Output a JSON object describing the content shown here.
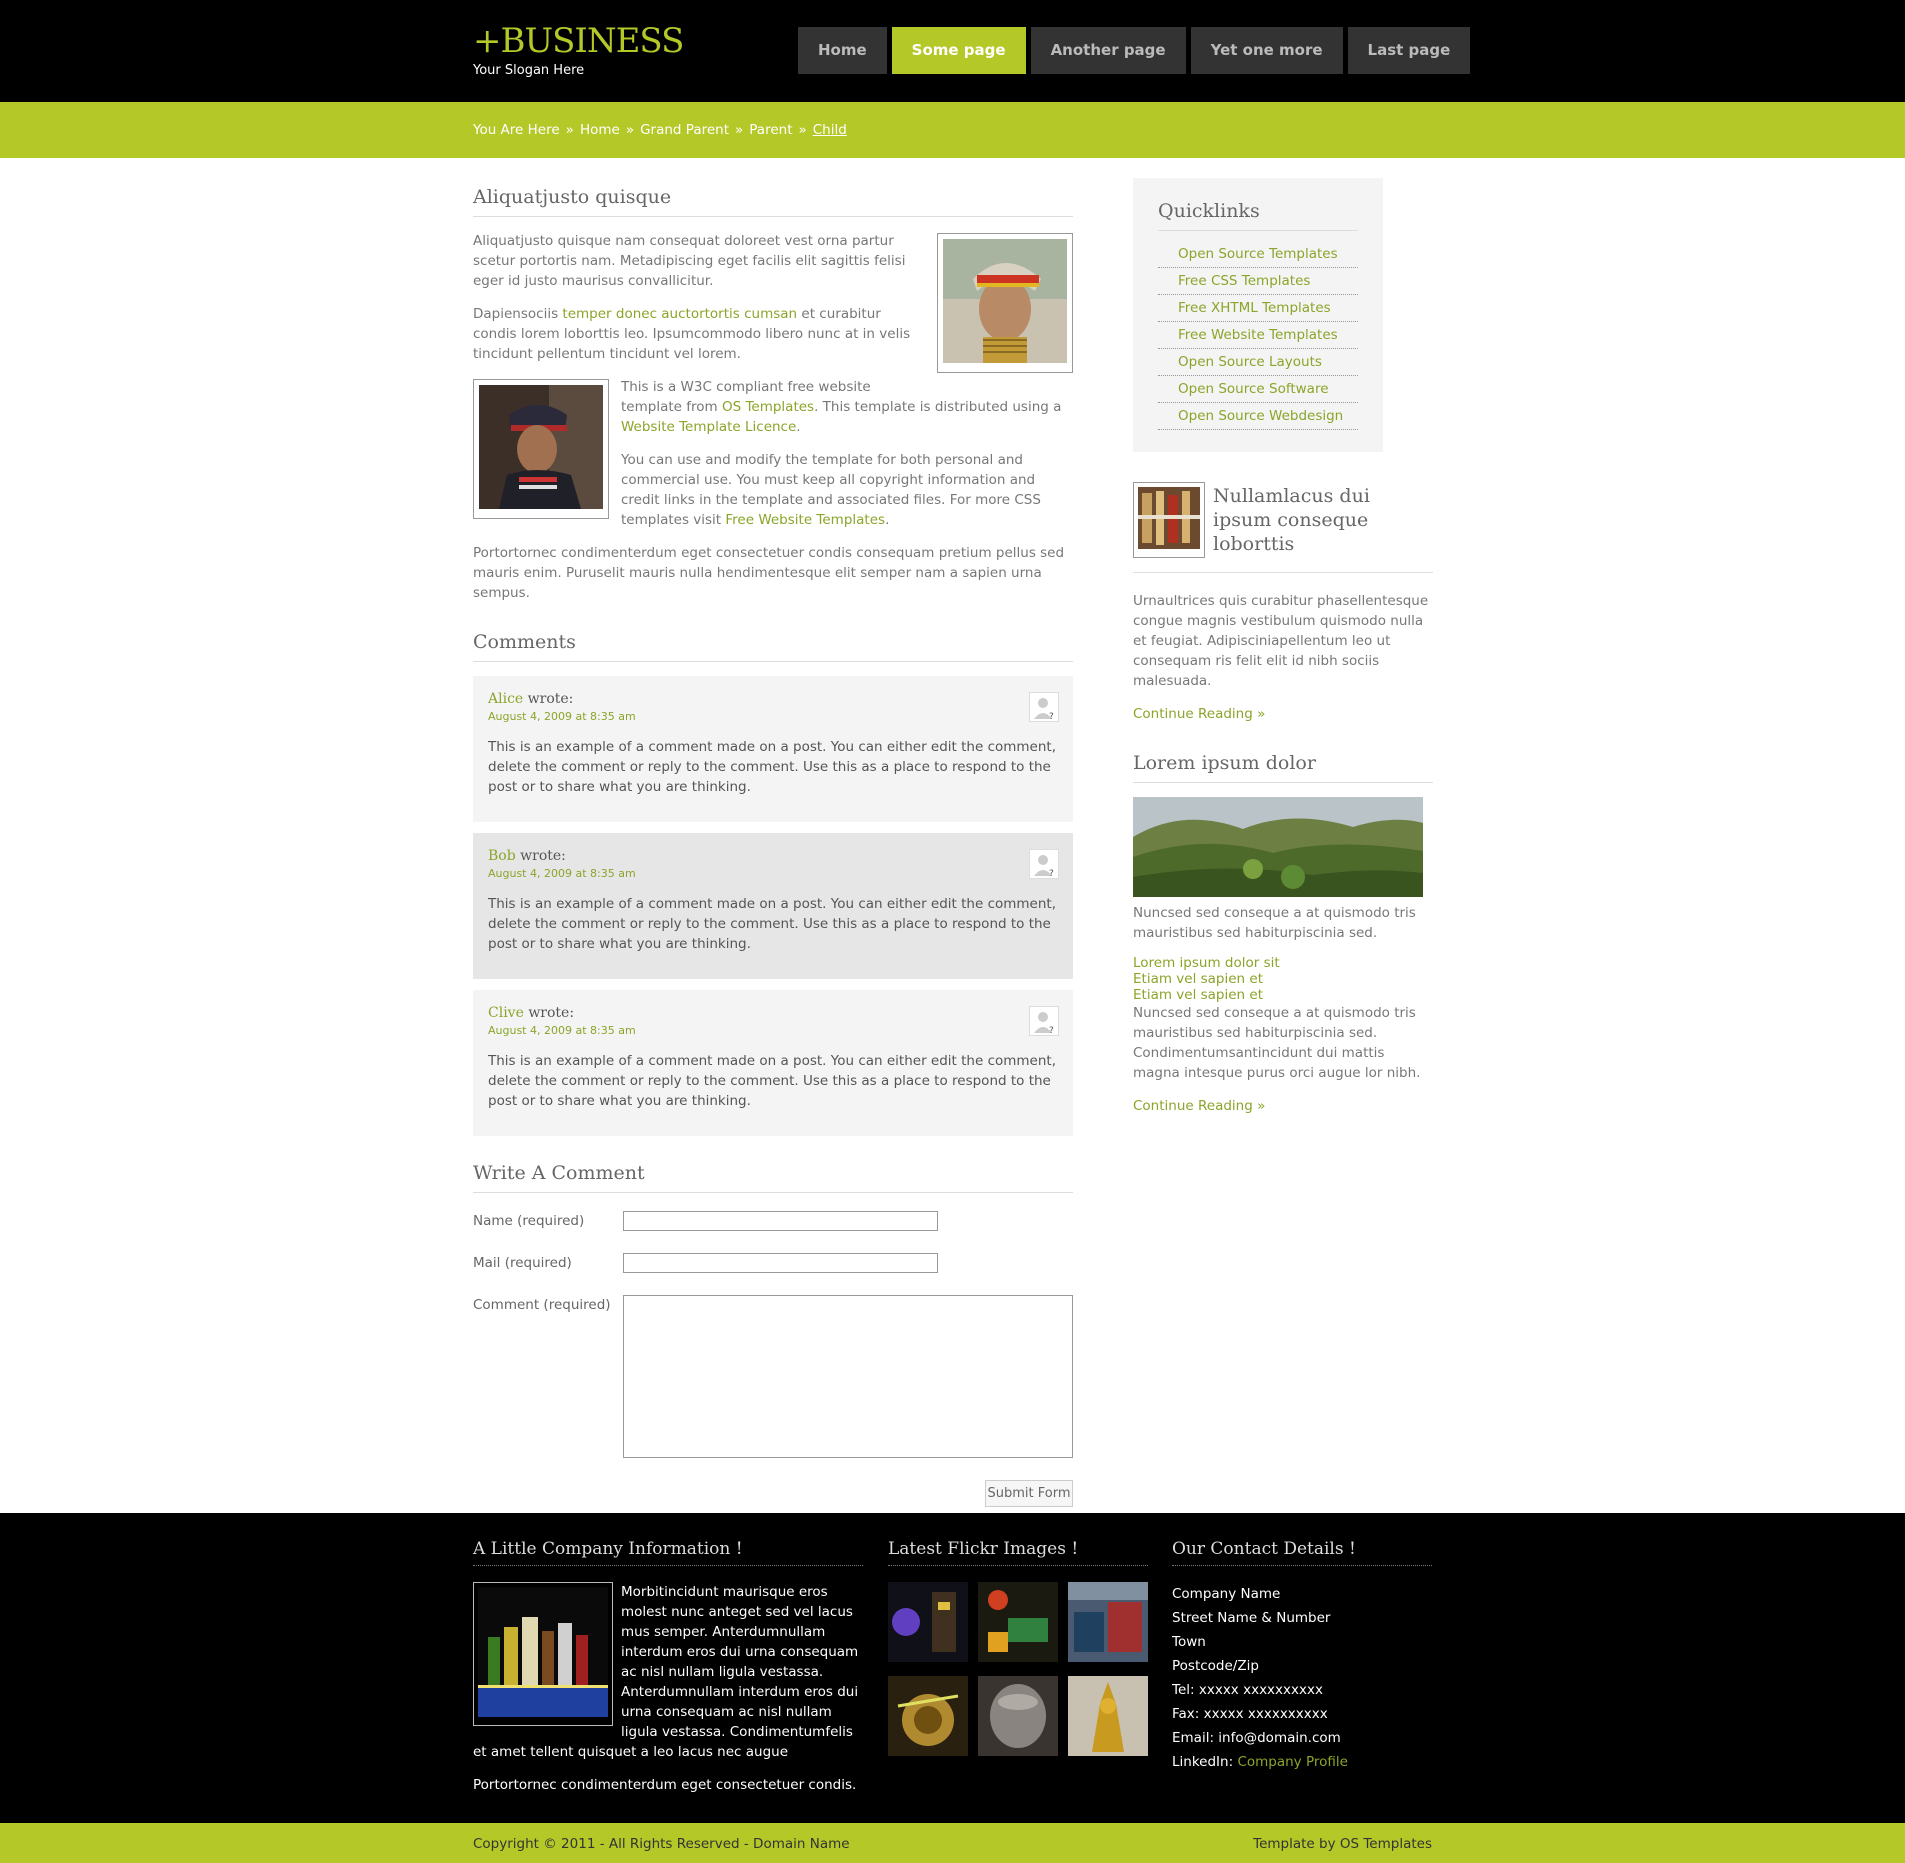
{
  "header": {
    "logo": "+BUSINESS",
    "slogan": "Your Slogan Here",
    "nav": [
      {
        "label": "Home"
      },
      {
        "label": "Some page"
      },
      {
        "label": "Another page"
      },
      {
        "label": "Yet one more"
      },
      {
        "label": "Last page"
      }
    ]
  },
  "breadcrumb": {
    "items": [
      "You Are Here",
      "Home",
      "Grand Parent",
      "Parent",
      "Child"
    ],
    "separator": "»"
  },
  "article": {
    "title": "Aliquatjusto quisque",
    "p1": "Aliquatjusto quisque nam consequat doloreet vest orna partur scetur portortis nam. Metadipiscing eget facilis elit sagittis felisi eger id justo maurisus convallicitur.",
    "p2_start": "Dapiensociis ",
    "p2_link": "temper donec auctortortis cumsan",
    "p2_end": " et curabitur condis lorem loborttis leo. Ipsumcommodo libero nunc at in velis tincidunt pellentum tincidunt vel lorem.",
    "p3_start": "This is a W3C compliant free website template from ",
    "p3_link1": "OS Templates",
    "p3_mid": ". This template is distributed using a ",
    "p3_link2": "Website Template Licence",
    "p3_end": ".",
    "p4_start": "You can use and modify the template for both personal and commercial use. You must keep all copyright information and credit links in the template and associated files. For more CSS templates visit ",
    "p4_link": "Free Website Templates",
    "p4_end": ".",
    "p5": "Portortornec condimenterdum eget consectetuer condis consequam pretium pellus sed mauris enim. Puruselit mauris nulla hendimentesque elit semper nam a sapien urna sempus."
  },
  "comments": {
    "title": "Comments",
    "wrote": "wrote:",
    "items": [
      {
        "author": "Alice",
        "date": "August 4, 2009 at 8:35 am",
        "text": "This is an example of a comment made on a post. You can either edit the comment, delete the comment or reply to the comment. Use this as a place to respond to the post or to share what you are thinking."
      },
      {
        "author": "Bob",
        "date": "August 4, 2009 at 8:35 am",
        "text": "This is an example of a comment made on a post. You can either edit the comment, delete the comment or reply to the comment. Use this as a place to respond to the post or to share what you are thinking."
      },
      {
        "author": "Clive",
        "date": "August 4, 2009 at 8:35 am",
        "text": "This is an example of a comment made on a post. You can either edit the comment, delete the comment or reply to the comment. Use this as a place to respond to the post or to share what you are thinking."
      }
    ]
  },
  "form": {
    "title": "Write A Comment",
    "name_label": "Name (required)",
    "mail_label": "Mail (required)",
    "comment_label": "Comment (required)",
    "name_value": "",
    "mail_value": "",
    "comment_value": "",
    "submit": "Submit Form"
  },
  "sidebar": {
    "quicklinks_title": "Quicklinks",
    "quicklinks": [
      "Open Source Templates",
      "Free CSS Templates",
      "Free XHTML Templates",
      "Free Website Templates",
      "Open Source Layouts",
      "Open Source Software",
      "Open Source Webdesign"
    ],
    "featured_title": "Nullamlacus dui ipsum conseque loborttis",
    "featured_text": "Urnaultrices quis curabitur phasellentesque congue magnis vestibulum quismodo nulla et feugiat. Adipisciniapellentum leo ut consequam ris felit elit id nibh sociis malesuada.",
    "continue1": "Continue Reading »",
    "lorem_title": "Lorem ipsum dolor",
    "lorem_text1": "Nuncsed sed conseque a at quismodo tris mauristibus sed habiturpiscinia sed.",
    "lorem_links": [
      "Lorem ipsum dolor sit",
      "Etiam vel sapien et",
      "Etiam vel sapien et"
    ],
    "lorem_text2": "Nuncsed sed conseque a at quismodo tris mauristibus sed habiturpiscinia sed. Condimentumsantincidunt dui mattis magna intesque purus orci augue lor nibh.",
    "continue2": "Continue Reading »"
  },
  "footer": {
    "company_title": "A Little Company Information !",
    "company_text": "Morbitincidunt maurisque eros molest nunc anteget sed vel lacus mus semper. Anterdumnullam interdum eros dui urna consequam ac nisl nullam ligula vestassa. Anterdumnullam interdum eros dui urna consequam ac nisl nullam ligula vestassa. Condimentumfelis et amet tellent quisquet a leo lacus nec augue",
    "company_text2": "Portortornec condimenterdum eget consectetuer condis.",
    "flickr_title": "Latest Flickr Images !",
    "contact_title": "Our Contact Details !",
    "contact": {
      "company": "Company Name",
      "street": "Street Name & Number",
      "town": "Town",
      "postcode": "Postcode/Zip",
      "tel": "Tel: xxxxx xxxxxxxxxx",
      "fax": "Fax: xxxxx xxxxxxxxxx",
      "email": "Email: info@domain.com",
      "linkedin_label": "LinkedIn:",
      "linkedin_link": "Company Profile"
    }
  },
  "copyright": {
    "left": "Copyright © 2011 - All Rights Reserved - Domain Name",
    "right": "Template by OS Templates"
  },
  "colors": {
    "accent": "#B4C828",
    "link": "#8AA52A",
    "header_bg": "#000000",
    "nav_bg": "#333333"
  }
}
